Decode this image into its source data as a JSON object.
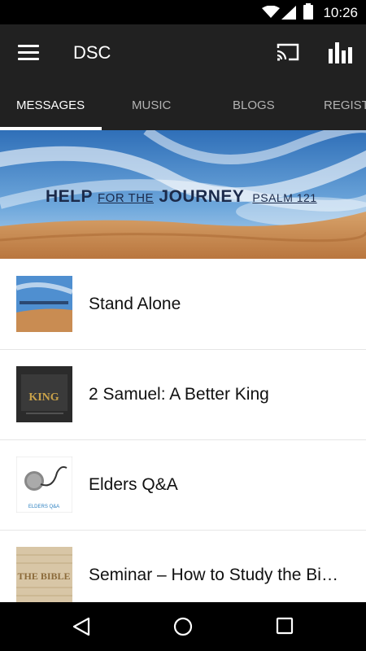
{
  "status_bar": {
    "time": "10:26"
  },
  "app_bar": {
    "title": "DSC"
  },
  "tabs": [
    {
      "label": "MESSAGES"
    },
    {
      "label": "MUSIC"
    },
    {
      "label": "BLOGS"
    },
    {
      "label": "REGIST"
    }
  ],
  "banner": {
    "help": "HELP",
    "for_the": "FOR THE",
    "journey": "JOURNEY",
    "psalm": "PSALM 121"
  },
  "messages": [
    {
      "title": "Stand Alone",
      "thumb": "help-for-the-journey-thumb"
    },
    {
      "title": "2 Samuel: A Better King",
      "thumb": "a-better-king-thumb",
      "thumb_text": "KING"
    },
    {
      "title": "Elders Q&A",
      "thumb": "elders-qa-thumb",
      "thumb_text": "ELDERS Q&A"
    },
    {
      "title": "Seminar – How to Study the Bi…",
      "thumb": "the-bible-thumb",
      "thumb_text": "THE BIBLE"
    }
  ],
  "colors": {
    "app_bar": "#212121",
    "status_bar": "#000000",
    "banner_text": "#1b2a4a"
  }
}
